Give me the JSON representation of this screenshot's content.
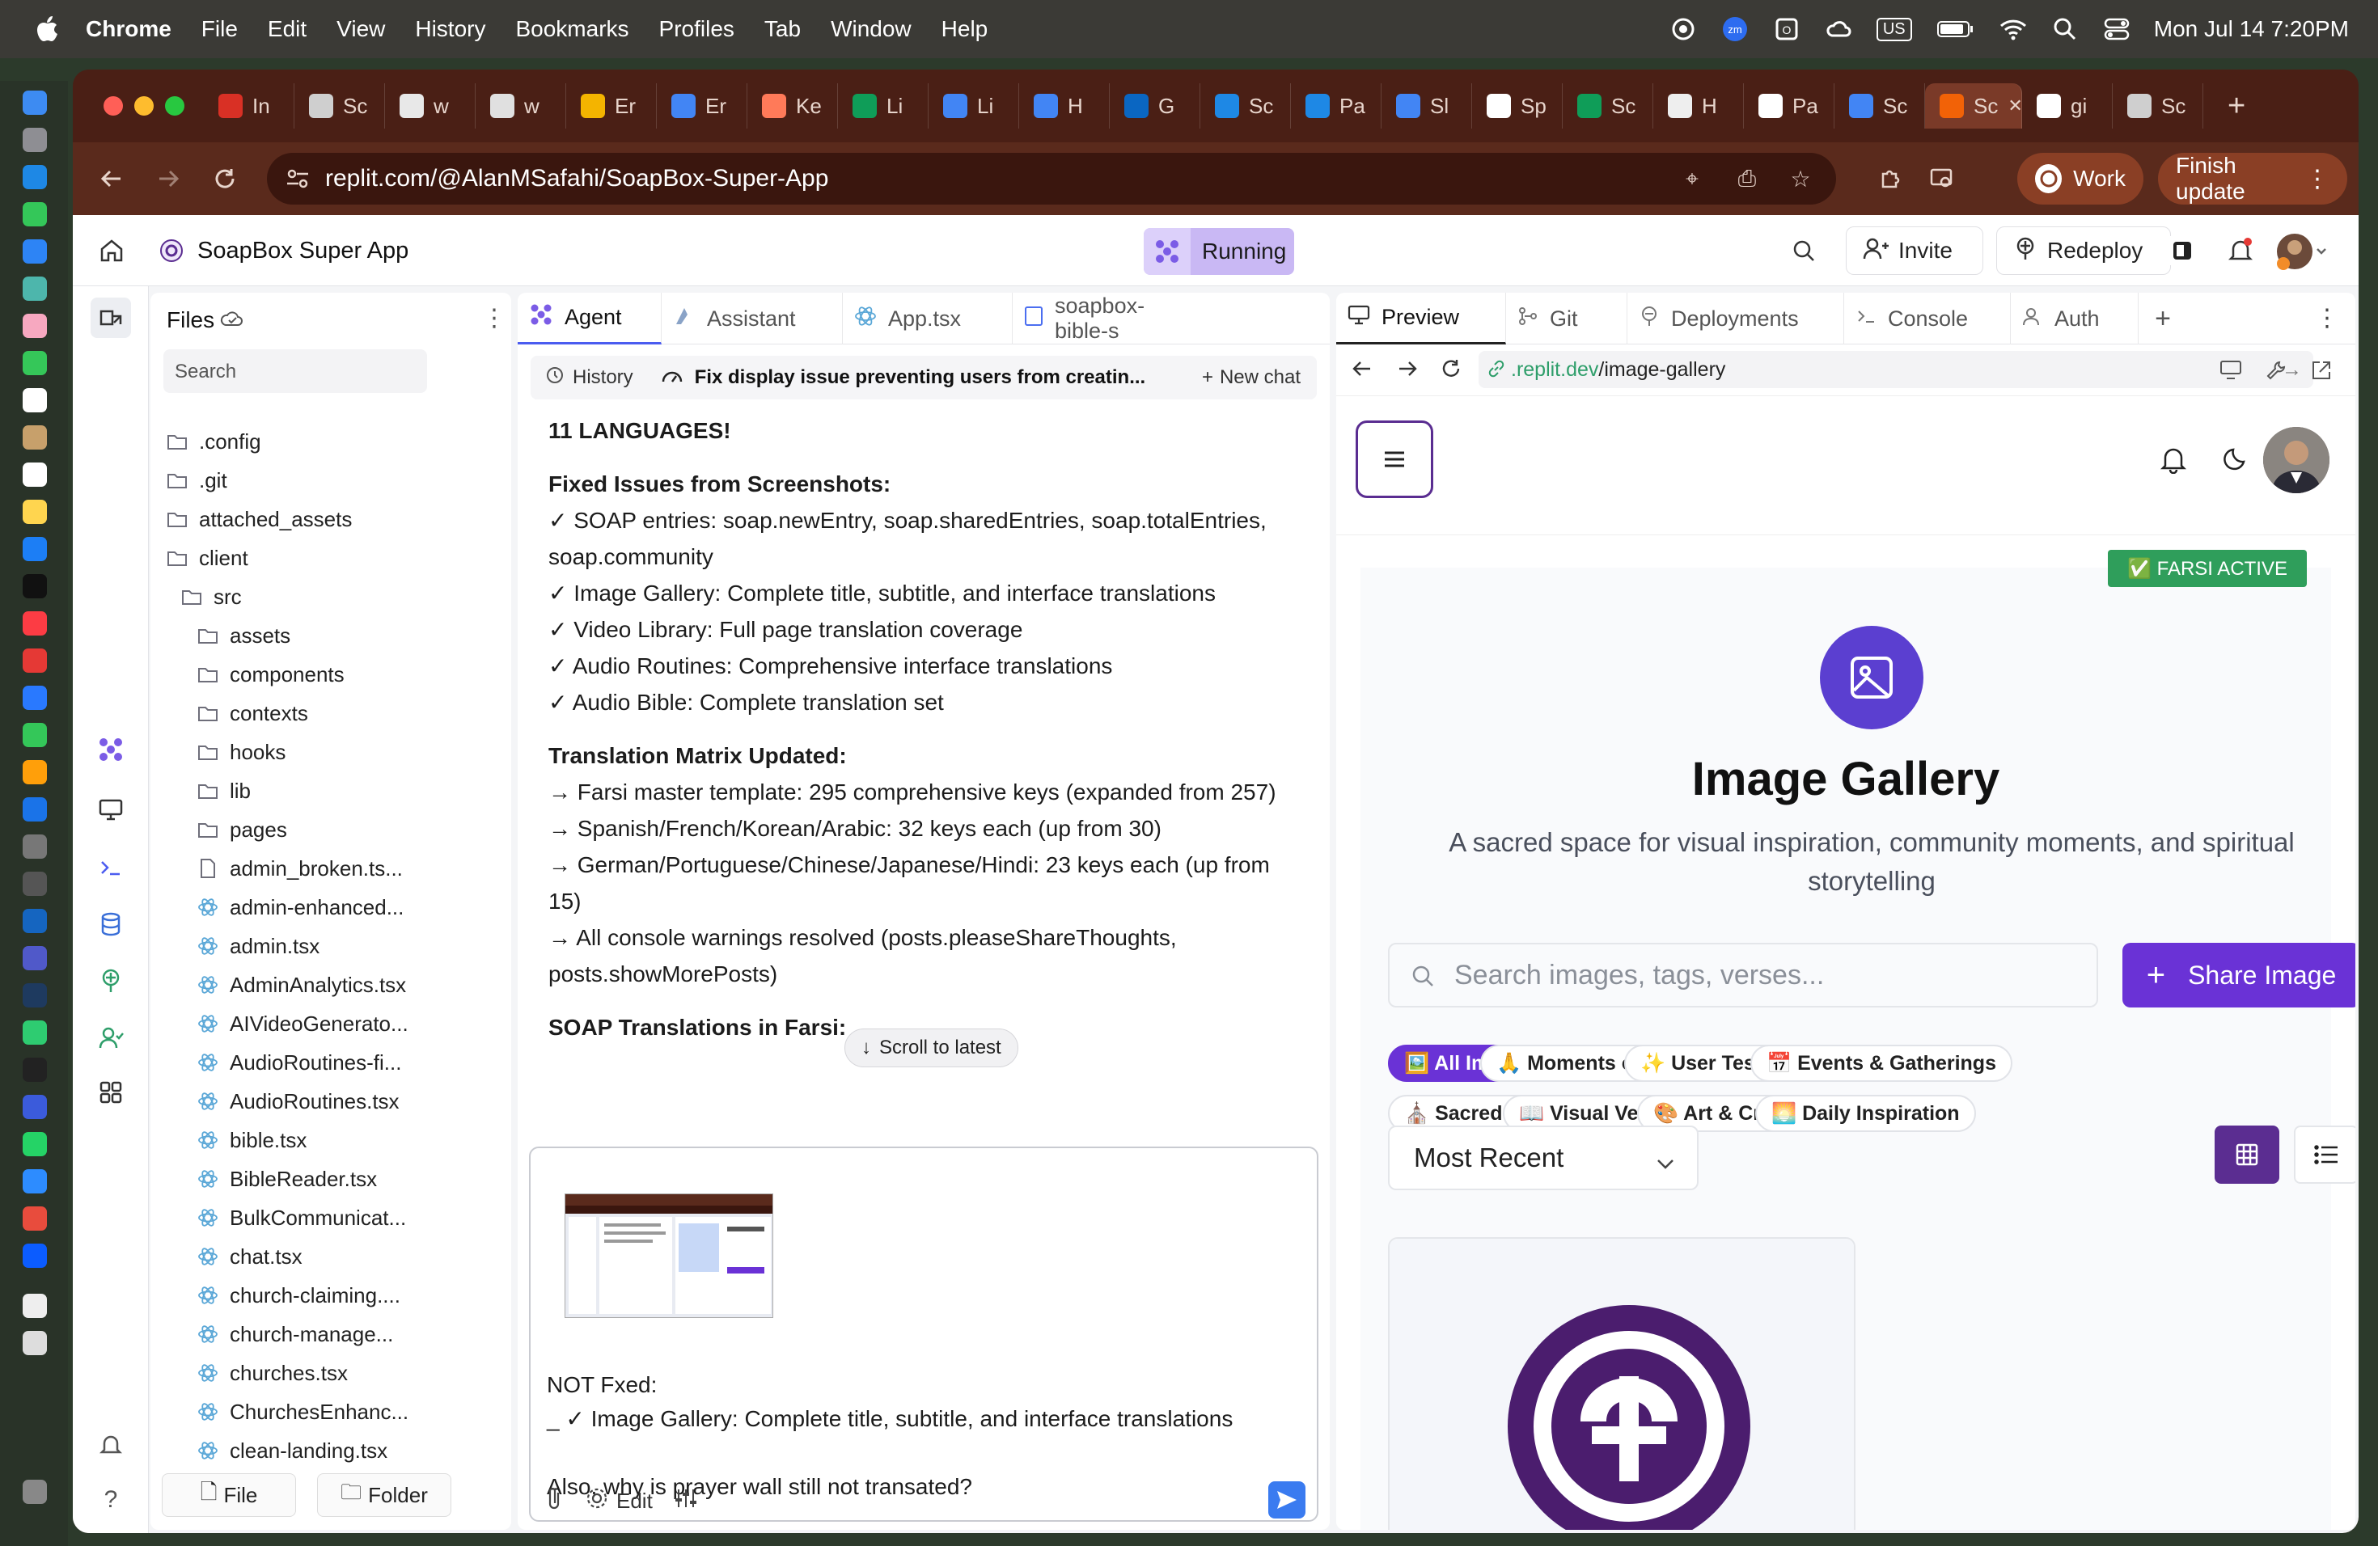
{
  "menubar": {
    "app": "Chrome",
    "items": [
      "File",
      "Edit",
      "View",
      "History",
      "Bookmarks",
      "Profiles",
      "Tab",
      "Window",
      "Help"
    ],
    "clock": "Mon Jul 14  7:20PM",
    "keyboard": "US"
  },
  "browser": {
    "tabs": [
      {
        "label": "In",
        "icon": "gmail-icon",
        "color": "#d93025"
      },
      {
        "label": "Sc",
        "icon": "globe-icon",
        "color": "#cfcfcf"
      },
      {
        "label": "w",
        "icon": "chrome-icon",
        "color": "#e8e8e8"
      },
      {
        "label": "w",
        "icon": "globe-icon",
        "color": "#e0e0e0"
      },
      {
        "label": "Er",
        "icon": "drive-icon",
        "color": "#f4b400"
      },
      {
        "label": "Er",
        "icon": "docs-icon",
        "color": "#4285f4"
      },
      {
        "label": "Ke",
        "icon": "hubspot-icon",
        "color": "#ff7a59"
      },
      {
        "label": "Li",
        "icon": "sheets-icon",
        "color": "#0f9d58"
      },
      {
        "label": "Li",
        "icon": "docs-icon",
        "color": "#4285f4"
      },
      {
        "label": "H",
        "icon": "docs-icon",
        "color": "#4285f4"
      },
      {
        "label": "G",
        "icon": "linkedin-icon",
        "color": "#0a66c2"
      },
      {
        "label": "Sc",
        "icon": "safari-icon",
        "color": "#1e88e5"
      },
      {
        "label": "Pa",
        "icon": "safari-icon",
        "color": "#1e88e5"
      },
      {
        "label": "Sl",
        "icon": "docs-icon",
        "color": "#4285f4"
      },
      {
        "label": "Sp",
        "icon": "slides-icon",
        "color": "#ffffff"
      },
      {
        "label": "Sc",
        "icon": "sheets-icon",
        "color": "#0f9d58"
      },
      {
        "label": "H",
        "icon": "openai-icon",
        "color": "#eeeeee"
      },
      {
        "label": "Pa",
        "icon": "github-icon",
        "color": "#ffffff"
      },
      {
        "label": "Sc",
        "icon": "docs-icon",
        "color": "#4285f4"
      },
      {
        "label": "Sc",
        "icon": "replit-icon",
        "color": "#f26207",
        "active": true
      },
      {
        "label": "gi",
        "icon": "github-icon",
        "color": "#ffffff"
      },
      {
        "label": "Sc",
        "icon": "globe-icon",
        "color": "#cfcfcf"
      }
    ],
    "url": "replit.com/@AlanMSafahi/SoapBox-Super-App",
    "profile": "Work",
    "finish_update": "Finish update"
  },
  "replit": {
    "project": "SoapBox Super App",
    "status": "Running",
    "invite": "Invite",
    "redeploy": "Redeploy"
  },
  "files": {
    "title": "Files",
    "search_placeholder": "Search",
    "items": [
      {
        "name": ".config",
        "type": "folder",
        "depth": 0
      },
      {
        "name": ".git",
        "type": "folder",
        "depth": 0
      },
      {
        "name": "attached_assets",
        "type": "folder",
        "depth": 0
      },
      {
        "name": "client",
        "type": "folder",
        "depth": 0
      },
      {
        "name": "src",
        "type": "folder",
        "depth": 1
      },
      {
        "name": "assets",
        "type": "folder",
        "depth": 2
      },
      {
        "name": "components",
        "type": "folder",
        "depth": 2
      },
      {
        "name": "contexts",
        "type": "folder",
        "depth": 2
      },
      {
        "name": "hooks",
        "type": "folder",
        "depth": 2
      },
      {
        "name": "lib",
        "type": "folder",
        "depth": 2
      },
      {
        "name": "pages",
        "type": "folder",
        "depth": 2
      },
      {
        "name": "admin_broken.ts...",
        "type": "file",
        "depth": 3
      },
      {
        "name": "admin-enhanced...",
        "type": "react",
        "depth": 3
      },
      {
        "name": "admin.tsx",
        "type": "react",
        "depth": 3
      },
      {
        "name": "AdminAnalytics.tsx",
        "type": "react",
        "depth": 3
      },
      {
        "name": "AIVideoGenerato...",
        "type": "react",
        "depth": 3
      },
      {
        "name": "AudioRoutines-fi...",
        "type": "react",
        "depth": 3
      },
      {
        "name": "AudioRoutines.tsx",
        "type": "react",
        "depth": 3
      },
      {
        "name": "bible.tsx",
        "type": "react",
        "depth": 3
      },
      {
        "name": "BibleReader.tsx",
        "type": "react",
        "depth": 3
      },
      {
        "name": "BulkCommunicat...",
        "type": "react",
        "depth": 3
      },
      {
        "name": "chat.tsx",
        "type": "react",
        "depth": 3
      },
      {
        "name": "church-claiming....",
        "type": "react",
        "depth": 3
      },
      {
        "name": "church-manage...",
        "type": "react",
        "depth": 3
      },
      {
        "name": "churches.tsx",
        "type": "react",
        "depth": 3
      },
      {
        "name": "ChurchesEnhanc...",
        "type": "react",
        "depth": 3
      },
      {
        "name": "clean-landing.tsx",
        "type": "react",
        "depth": 3
      }
    ],
    "file_btn": "File",
    "folder_btn": "Folder"
  },
  "agent": {
    "tabs": [
      "Agent",
      "Assistant",
      "App.tsx",
      "soapbox-bible-s"
    ],
    "history": "History",
    "chat_title": "Fix display issue preventing users from creatin...",
    "new_chat": "New chat",
    "lines": [
      {
        "t": "11 LANGUAGES!",
        "b": true
      },
      {
        "t": "",
        "gap": true
      },
      {
        "t": "Fixed Issues from Screenshots:",
        "b": true
      },
      {
        "t": "✓ SOAP entries: soap.newEntry, soap.sharedEntries, soap.totalEntries,"
      },
      {
        "t": "soap.community"
      },
      {
        "t": "✓ Image Gallery: Complete title, subtitle, and interface translations"
      },
      {
        "t": "✓ Video Library: Full page translation coverage"
      },
      {
        "t": "✓ Audio Routines: Comprehensive interface translations"
      },
      {
        "t": "✓ Audio Bible: Complete translation set"
      },
      {
        "t": "",
        "gap": true
      },
      {
        "t": "Translation Matrix Updated:",
        "b": true
      },
      {
        "t": "→ Farsi master template: 295 comprehensive keys (expanded from 257)"
      },
      {
        "t": "→ Spanish/French/Korean/Arabic: 32 keys each (up from 30)"
      },
      {
        "t": "→ German/Portuguese/Chinese/Japanese/Hindi: 23 keys each (up from"
      },
      {
        "t": "15)"
      },
      {
        "t": "→ All console warnings resolved (posts.pleaseShareThoughts,"
      },
      {
        "t": "posts.showMorePosts)"
      },
      {
        "t": "",
        "gap": true
      },
      {
        "t": "SOAP Translations in Farsi:",
        "b": true
      }
    ],
    "scroll_latest": "Scroll to latest",
    "composer_text": "NOT Fxed:\n_ ✓ Image Gallery: Complete title, subtitle, and interface translations\n\nAlso, why is prayer wall still not transated?",
    "edit": "Edit"
  },
  "preview": {
    "tabs": [
      "Preview",
      "Git",
      "Deployments",
      "Console",
      "Auth"
    ],
    "url_prefix": ".replit.dev",
    "url_path": "/image-gallery",
    "farsi_badge": "✅ FARSI ACTIVE",
    "title": "Image Gallery",
    "subtitle": "A sacred space for visual inspiration, community moments, and spiritual storytelling",
    "search_placeholder": "Search images, tags, verses...",
    "share": "Share Image",
    "chips": [
      "🖼️ All Images",
      "🙏 Moments of Worship",
      "✨ User Testimonies",
      "📅 Events & Gatherings",
      "⛪ Sacred Spaces",
      "📖 Visual Verse Cards",
      "🎨 Art & Creativity",
      "🌅 Daily Inspiration"
    ],
    "sort": "Most Recent"
  }
}
